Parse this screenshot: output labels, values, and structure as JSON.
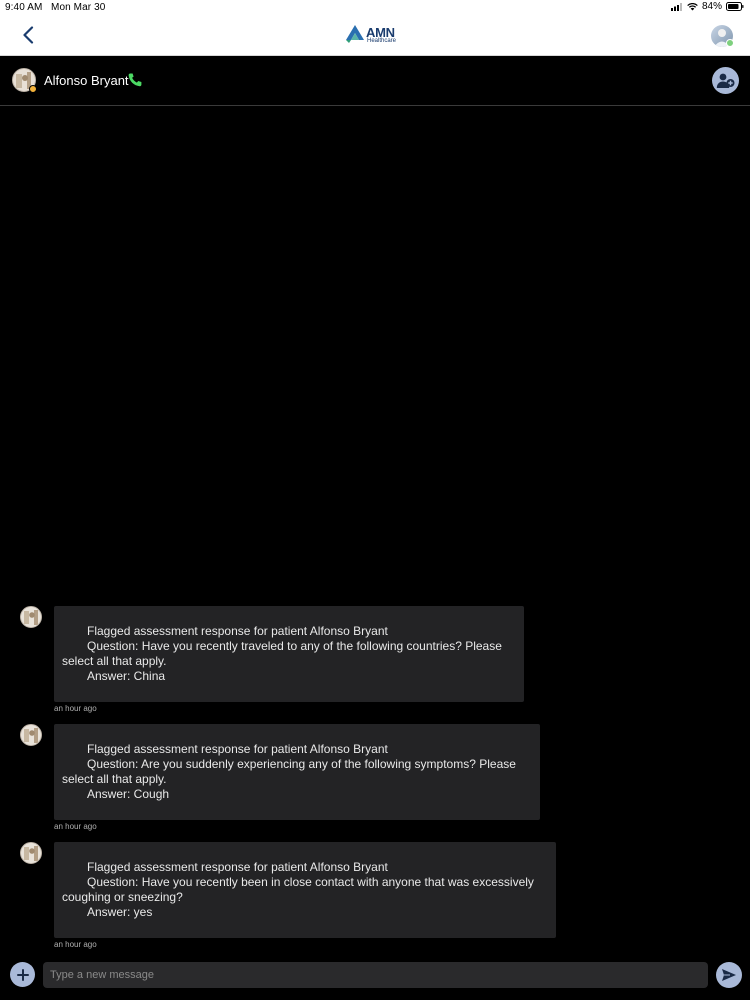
{
  "status_bar": {
    "time": "9:40 AM",
    "date": "Mon Mar 30",
    "battery": "84%"
  },
  "nav": {
    "logo_text": "AMN",
    "logo_sub": "Healthcare"
  },
  "conversation": {
    "contact_name": "Alfonso Bryant"
  },
  "messages": [
    {
      "title": "Flagged assessment response for patient Alfonso Bryant",
      "question_line1": "Question: Have you recently traveled to any of the following countries? Please",
      "question_line2": "select all that apply.",
      "answer": "Answer: China",
      "time": "an hour ago"
    },
    {
      "title": "Flagged assessment response for patient Alfonso Bryant",
      "question_line1": "Question: Are you suddenly experiencing any of the following symptoms? Please",
      "question_line2": "select all that apply.",
      "answer": "Answer: Cough",
      "time": "an hour ago"
    },
    {
      "title": "Flagged assessment response for patient Alfonso Bryant",
      "question_line1": "Question: Have you recently been in close contact with anyone that was excessively",
      "question_line2": "coughing or sneezing?",
      "answer": "Answer: yes",
      "time": "an hour ago"
    }
  ],
  "composer": {
    "placeholder": "Type a new message"
  },
  "icons": {
    "back": "chevron-left-icon",
    "phone": "phone-icon",
    "add_participant": "add-person-icon",
    "plus": "plus-icon",
    "send": "send-icon"
  },
  "colors": {
    "brand_navy": "#1a3c6e",
    "accent_lavender": "#a9b9d8",
    "bubble": "#232325",
    "phone_green": "#4cd964"
  }
}
